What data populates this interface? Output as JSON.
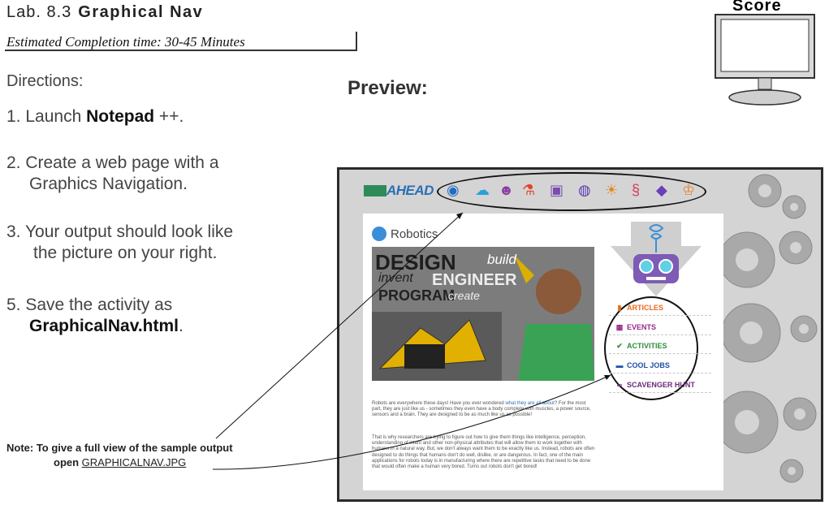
{
  "header": {
    "lab_number": "Lab. 8.3",
    "lab_name": "Graphical Nav",
    "estimated_time": "Estimated Completion time: 30-45 Minutes"
  },
  "score": {
    "label": "Score"
  },
  "directions": {
    "heading": "Directions:",
    "step1_prefix": "1. Launch ",
    "step1_bold": "Notepad",
    "step1_suffix": " ++.",
    "step2_line1": "2. Create a web page with a",
    "step2_line2": "Graphics Navigation.",
    "step3_line1": "3.  Your output should look like",
    "step3_line2": "the picture on your right.",
    "step5_line1": "5. Save the activity as",
    "step5_bold": "GraphicalNav.html",
    "step5_suffix": "."
  },
  "preview": {
    "label": "Preview:",
    "logo_text": "AHEAD",
    "page_title": "Robotics",
    "hero": {
      "design": "DESIGN",
      "build": "build",
      "invent": "invent",
      "engineer": "ENGINEER",
      "program": "PROGRAM",
      "create": "create"
    },
    "sidebar": [
      {
        "label": "ARTICLES",
        "color": "#e86b1f",
        "icon": "article-icon",
        "glyph": "▮"
      },
      {
        "label": "EVENTS",
        "color": "#9a2a8c",
        "icon": "calendar-icon",
        "glyph": "▦"
      },
      {
        "label": "ACTIVITIES",
        "color": "#2f8d3a",
        "icon": "wrench-icon",
        "glyph": "✔"
      },
      {
        "label": "COOL JOBS",
        "color": "#1e4fa3",
        "icon": "briefcase-icon",
        "glyph": "▬"
      },
      {
        "label": "SCAVENGER HUNT",
        "color": "#6a2a7a",
        "icon": "binoculars-icon",
        "glyph": "∞"
      }
    ],
    "nav_icons": [
      {
        "icon": "eye-icon",
        "glyph": "◉",
        "color": "#1f6cc1"
      },
      {
        "icon": "cloud-icon",
        "glyph": "☁",
        "color": "#2aa0d8"
      },
      {
        "icon": "brain-icon",
        "glyph": "☻",
        "color": "#8a3fa0"
      },
      {
        "icon": "flask-icon",
        "glyph": "⚗",
        "color": "#e0452c"
      },
      {
        "icon": "robot-icon",
        "glyph": "▣",
        "color": "#7a4bb0"
      },
      {
        "icon": "planet-icon",
        "glyph": "◍",
        "color": "#5a3bb0"
      },
      {
        "icon": "lion-icon",
        "glyph": "☀",
        "color": "#e08a1c"
      },
      {
        "icon": "seahorse-icon",
        "glyph": "§",
        "color": "#d23a5a"
      },
      {
        "icon": "gamepad-icon",
        "glyph": "◆",
        "color": "#6a3fb8"
      },
      {
        "icon": "trophy-icon",
        "glyph": "♔",
        "color": "#e8802a"
      }
    ],
    "paragraph1_a": "Robots are everywhere these days! Have you ever wondered ",
    "paragraph1_link": "what they are all about",
    "paragraph1_b": "? For the most part, they are just like us - sometimes they even have a body complete with muscles, a power source, sensors and a brain.  They are designed to be as much like us as possible!",
    "paragraph2": "That is why researchers are trying to figure out how to give them things like intelligence, perception, understanding of intent and other non-physical attributes that will allow them to work together with humans in a natural way. But, we don't always want them to be exactly like us. Instead, robots are often designed to do things that humans don't do well, dislike, or are dangerous.  In fact, one of the main applications for robots today is in manufacturing where there are repetitive tasks that need to be done that would often make a human very bored.  Turns out robots don't get bored!"
  },
  "note": {
    "line1": "Note: To give a full view of the sample output",
    "line2_prefix": "open ",
    "line2_link": "GRAPHICALNAV.JPG"
  },
  "colors": {
    "frame_bg": "#d4d4d4",
    "accent_blue": "#2b6fb5"
  }
}
